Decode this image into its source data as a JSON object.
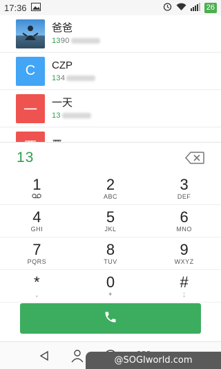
{
  "status_bar": {
    "time": "17:36",
    "battery": "26"
  },
  "contacts": [
    {
      "name": "爸爸",
      "number_match": "13",
      "number_rest": "90",
      "avatar_text": ""
    },
    {
      "name": "CZP",
      "number_match": "13",
      "number_rest": "4",
      "avatar_text": "C",
      "avatar_color": "#42a5f5"
    },
    {
      "name": "一天",
      "number_match": "13",
      "number_rest": "",
      "avatar_text": "一",
      "avatar_color": "#ef5350"
    },
    {
      "name": "严",
      "number_match": "",
      "number_rest": "",
      "avatar_text": "严",
      "avatar_color": "#ef5350"
    }
  ],
  "dialer": {
    "input": "13"
  },
  "keypad": [
    {
      "digit": "1",
      "letters": ""
    },
    {
      "digit": "2",
      "letters": "ABC"
    },
    {
      "digit": "3",
      "letters": "DEF"
    },
    {
      "digit": "4",
      "letters": "GHI"
    },
    {
      "digit": "5",
      "letters": "JKL"
    },
    {
      "digit": "6",
      "letters": "MNO"
    },
    {
      "digit": "7",
      "letters": "PQRS"
    },
    {
      "digit": "8",
      "letters": "TUV"
    },
    {
      "digit": "9",
      "letters": "WXYZ"
    },
    {
      "digit": "*",
      "letters": ","
    },
    {
      "digit": "0",
      "letters": "+"
    },
    {
      "digit": "#",
      "letters": ";"
    }
  ],
  "colors": {
    "accent_green": "#3cad5e",
    "match_green": "#2e9e4e"
  },
  "watermark": "@SOGIworld.com"
}
